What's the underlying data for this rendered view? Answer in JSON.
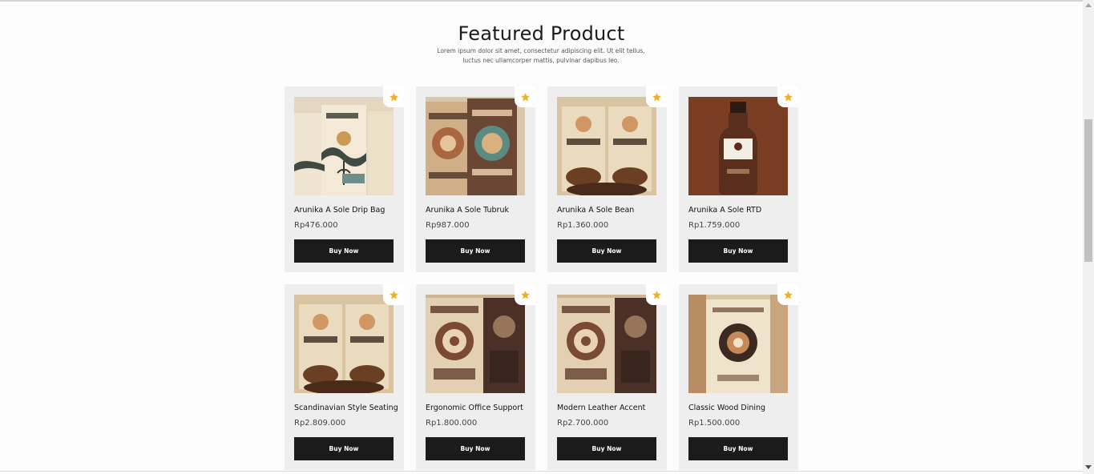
{
  "section": {
    "title": "Featured Product",
    "description": "Lorem ipsum dolor sit amet, consectetur adipiscing elit. Ut elit tellus, luctus nec ullamcorper mattis, pulvinar dapibus leo."
  },
  "colors": {
    "star": "#f2b01e",
    "button_bg": "#1b1b1b",
    "card_bg": "#eeeeee"
  },
  "buy_label": "Buy Now",
  "products": [
    {
      "name": "Arunika A Sole Drip Bag",
      "price": "Rp476.000",
      "image": "coffee-drip-bag-packages"
    },
    {
      "name": "Arunika A Sole Tubruk",
      "price": "Rp987.000",
      "image": "kopi-tubruk-bags"
    },
    {
      "name": "Arunika A Sole Bean",
      "price": "Rp1.360.000",
      "image": "coffee-bean-bags"
    },
    {
      "name": "Arunika A Sole RTD",
      "price": "Rp1.759.000",
      "image": "coffee-bottle"
    },
    {
      "name": "Scandinavian Style Seating",
      "price": "Rp2.809.000",
      "image": "coffee-bean-bags"
    },
    {
      "name": "Ergonomic Office Support",
      "price": "Rp1.800.000",
      "image": "batik-coffee-bags"
    },
    {
      "name": "Modern Leather Accent",
      "price": "Rp2.700.000",
      "image": "batik-coffee-bags"
    },
    {
      "name": "Classic Wood Dining",
      "price": "Rp1.500.000",
      "image": "mandala-coffee-box"
    }
  ]
}
